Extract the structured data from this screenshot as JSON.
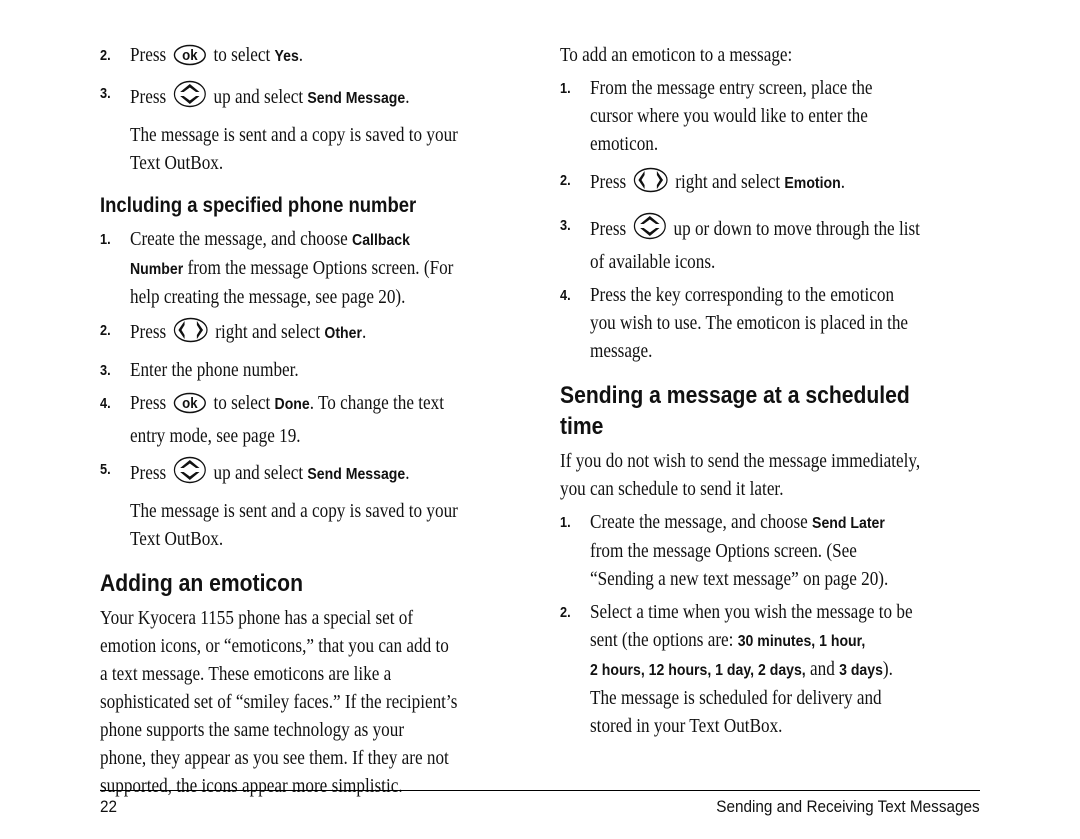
{
  "left": {
    "steps_top": [
      {
        "num": "2.",
        "parts": [
          "Press",
          "ok-key",
          "to select",
          "Yes",
          "."
        ]
      },
      {
        "num": "3.",
        "parts": [
          "Press",
          "updown-key",
          "up and select",
          "Send Message",
          "."
        ]
      }
    ],
    "step2_pre": "Press",
    "step2_post": "to select",
    "step2_bold": "Yes",
    "step3_pre": "Press",
    "step3_post": "up and select",
    "step3_bold": "Send Message",
    "sent_note_1": "The message is sent and a copy is saved to your",
    "sent_note_2": "Text OutBox.",
    "heading_callback": "Including a specified phone number",
    "cb1_num": "1.",
    "cb1_line1_pre": "Create the message, and choose",
    "cb1_line1_bold": "Callback",
    "cb1_line2_bold": "Number",
    "cb1_line2_post": "from the message Options screen. (For",
    "cb1_line3": "help creating the message, see page 20).",
    "cb2_num": "2.",
    "cb2_pre": "Press",
    "cb2_post": "right and select",
    "cb2_bold": "Other",
    "cb3_num": "3.",
    "cb3_text": "Enter the phone number.",
    "cb4_num": "4.",
    "cb4_pre": "Press",
    "cb4_post": "to select",
    "cb4_bold": "Done",
    "cb4_tail": ". To change the text",
    "cb4_line2": "entry mode, see page 19.",
    "cb5_num": "5.",
    "cb5_pre": "Press",
    "cb5_post": "up and select",
    "cb5_bold": "Send Message",
    "cb5_note_1": "The message is sent and a copy is saved to your",
    "cb5_note_2": "Text OutBox.",
    "heading_emoticon": "Adding an emoticon",
    "emoticon_para": [
      "Your Kyocera 1155 phone has a special set of",
      "emotion icons, or “emoticons,” that you can add to",
      "a text message. These emoticons are like a",
      "sophisticated set of “smiley faces.” If the recipient’s",
      "phone supports the same technology as your",
      "phone, they appear as you see them. If they are not",
      "supported, the icons appear more simplistic."
    ]
  },
  "right": {
    "intro": "To add an emoticon to a message:",
    "e1_num": "1.",
    "e1_lines": [
      "From the message entry screen, place the",
      "cursor where you would like to enter the",
      "emoticon."
    ],
    "e2_num": "2.",
    "e2_pre": "Press",
    "e2_post": "right and select",
    "e2_bold": "Emotion",
    "e3_num": "3.",
    "e3_pre": "Press",
    "e3_post": "up or down to move through the list",
    "e3_line2": "of available icons.",
    "e4_num": "4.",
    "e4_lines": [
      "Press the key corresponding to the emoticon",
      "you wish to use. The emoticon is placed in the",
      "message."
    ],
    "heading_scheduled_1": "Sending a message at a scheduled",
    "heading_scheduled_2": "time",
    "sched_para_1": "If you do not wish to send the message immediately,",
    "sched_para_2": "you can schedule to send it later.",
    "s1_num": "1.",
    "s1_line1_pre": "Create the message, and choose",
    "s1_line1_bold": "Send Later",
    "s1_line2": "from the message Options screen. (See",
    "s1_line3": "“Sending a new text message” on page 20).",
    "s2_num": "2.",
    "s2_line1": "Select a time when you wish the message to be",
    "s2_line2_pre": "sent (the options are:",
    "s2_line2_bold": "30 minutes, 1 hour,",
    "s2_line3_bold": "2 hours, 12 hours, 1 day, 2 days,",
    "s2_line3_mid": "and",
    "s2_line3_bold2": "3 days",
    "s2_line3_tail": ").",
    "s2_line4": "The message is scheduled for delivery and",
    "s2_line5": "stored in your Text OutBox."
  },
  "footer": {
    "page_number": "22",
    "chapter_title": "Sending and Receiving Text Messages"
  },
  "icons": {
    "ok_key": "ok-key-icon",
    "updown_key": "up-down-navigation-key-icon",
    "leftright_key": "left-right-navigation-key-icon",
    "ok_label": "ok"
  }
}
